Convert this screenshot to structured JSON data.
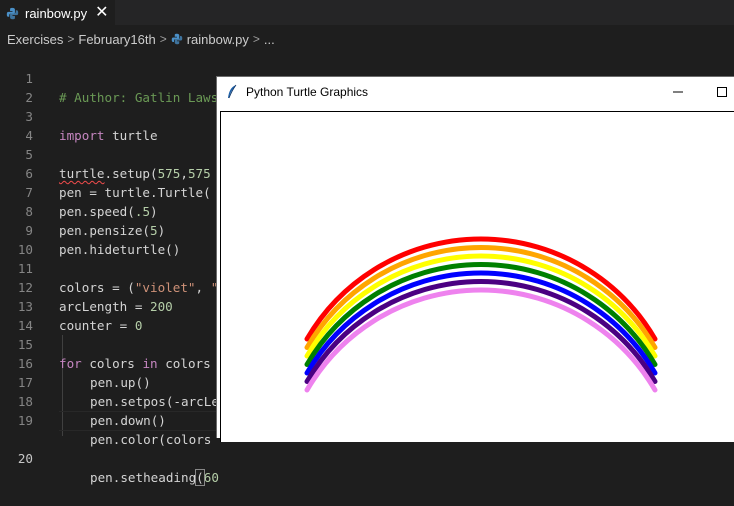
{
  "editor": {
    "tab": {
      "label": "rainbow.py",
      "close": "✕"
    },
    "breadcrumb": [
      "Exercises",
      "February16th",
      "rainbow.py",
      "..."
    ],
    "lines": [
      {
        "n": "1"
      },
      {
        "n": "2"
      },
      {
        "n": "3"
      },
      {
        "n": "4"
      },
      {
        "n": "5"
      },
      {
        "n": "6"
      },
      {
        "n": "7"
      },
      {
        "n": "8"
      },
      {
        "n": "9"
      },
      {
        "n": "10"
      },
      {
        "n": "11"
      },
      {
        "n": "12"
      },
      {
        "n": "13"
      },
      {
        "n": "14"
      },
      {
        "n": "15"
      },
      {
        "n": "16"
      },
      {
        "n": "17"
      },
      {
        "n": "18"
      },
      {
        "n": "19"
      },
      {
        "n": "20"
      }
    ],
    "code": {
      "l1": "# Author: Gatlin Lawson",
      "l3_kw": "import",
      "l3_rest": " turtle",
      "l5_a": "turtle",
      "l5_b": ".setup",
      "l5_c": "(",
      "l5_d": "575",
      "l5_e": ",",
      "l5_f": "575",
      "l6_a": "pen",
      "l6_b": " = ",
      "l6_c": "turtle",
      "l6_d": ".",
      "l6_e": "Turtle",
      "l6_f": "(",
      "l7_a": "pen",
      "l7_b": ".",
      "l7_c": "speed",
      "l7_d": "(",
      "l7_e": ".5",
      "l7_f": ")",
      "l8_a": "pen",
      "l8_b": ".",
      "l8_c": "pensize",
      "l8_d": "(",
      "l8_e": "5",
      "l8_f": ")",
      "l9_a": "pen",
      "l9_b": ".",
      "l9_c": "hideturtle",
      "l9_d": "()",
      "l11_a": "colors",
      "l11_b": " = (",
      "l11_c": "\"violet\"",
      "l11_d": ", ",
      "l11_e": "\"",
      "l12_a": "arcLength",
      "l12_b": " = ",
      "l12_c": "200",
      "l13_a": "counter",
      "l13_b": " = ",
      "l13_c": "0",
      "l15_a": "for",
      "l15_b": " ",
      "l15_c": "colors",
      "l15_d": " ",
      "l15_e": "in",
      "l15_f": " ",
      "l15_g": "colors",
      "l16_a": "pen",
      "l16_b": ".",
      "l16_c": "up",
      "l16_d": "()",
      "l17_a": "pen",
      "l17_b": ".",
      "l17_c": "setpos",
      "l17_d": "(-",
      "l17_e": "arcLe",
      "l18_a": "pen",
      "l18_b": ".",
      "l18_c": "down",
      "l18_d": "()",
      "l19_a": "pen",
      "l19_b": ".",
      "l19_c": "color",
      "l19_d": "(",
      "l19_e": "colors",
      "l20_a": "pen",
      "l20_b": ".",
      "l20_c": "setheading",
      "l20_d": "(",
      "l20_e": "60"
    }
  },
  "turtle_window": {
    "title": "Python Turtle Graphics",
    "rainbow_colors": [
      "#ff0000",
      "#ffa500",
      "#ffff00",
      "#008000",
      "#0000ff",
      "#4b0082",
      "#ee82ee"
    ]
  },
  "colors": {
    "editor_bg": "#1e1e1e",
    "comment": "#6a9955",
    "keyword": "#c586c0",
    "string": "#ce9178",
    "number": "#b5cea8",
    "function": "#dcdcaa",
    "variable": "#9cdcfe"
  }
}
